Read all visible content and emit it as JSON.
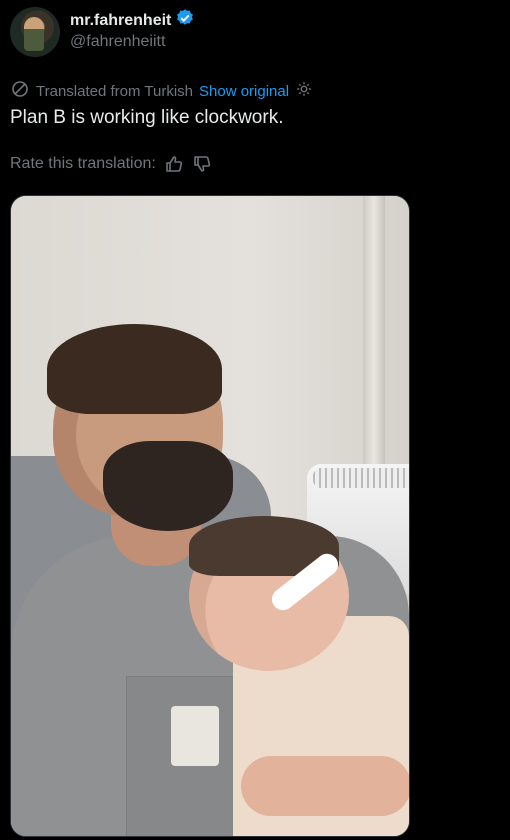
{
  "header": {
    "display_name": "mr.fahrenheit",
    "handle": "@fahrenheiitt"
  },
  "translation": {
    "label": "Translated from Turkish",
    "show_original": "Show original"
  },
  "tweet": {
    "text": "Plan B is working like clockwork."
  },
  "rating": {
    "label": "Rate this translation:"
  },
  "colors": {
    "accent": "#1d9bf0",
    "muted": "#71767b",
    "background": "#000000"
  },
  "icons": [
    "verified-badge-icon",
    "translate-icon",
    "settings-icon",
    "thumbs-up-icon",
    "thumbs-down-icon"
  ]
}
